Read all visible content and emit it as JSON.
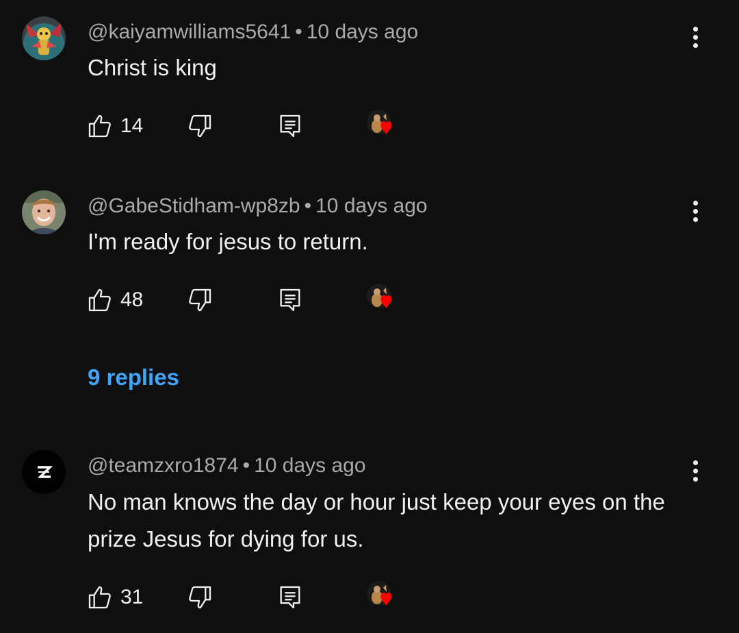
{
  "comments": [
    {
      "handle": "@kaiyamwilliams5641",
      "time": "10 days ago",
      "text": "Christ is king",
      "likes": "14",
      "avatar": "character-avatar",
      "creator_heart": true
    },
    {
      "handle": "@GabeStidham-wp8zb",
      "time": "10 days ago",
      "text": "I'm ready for jesus to return.",
      "likes": "48",
      "avatar": "person-photo-avatar",
      "creator_heart": true,
      "replies_label": "9 replies"
    },
    {
      "handle": "@teamzxro1874",
      "time": "10 days ago",
      "text": "No man knows the day or hour just keep your eyes on the prize Jesus for dying for us.",
      "likes": "31",
      "avatar": "z-logo-avatar",
      "creator_heart": true
    }
  ],
  "separator": "•",
  "colors": {
    "background": "#0f0f0f",
    "text": "#f1f1f1",
    "meta": "#aaaaaa",
    "link": "#3ea6ff",
    "heart": "#ff0000"
  }
}
